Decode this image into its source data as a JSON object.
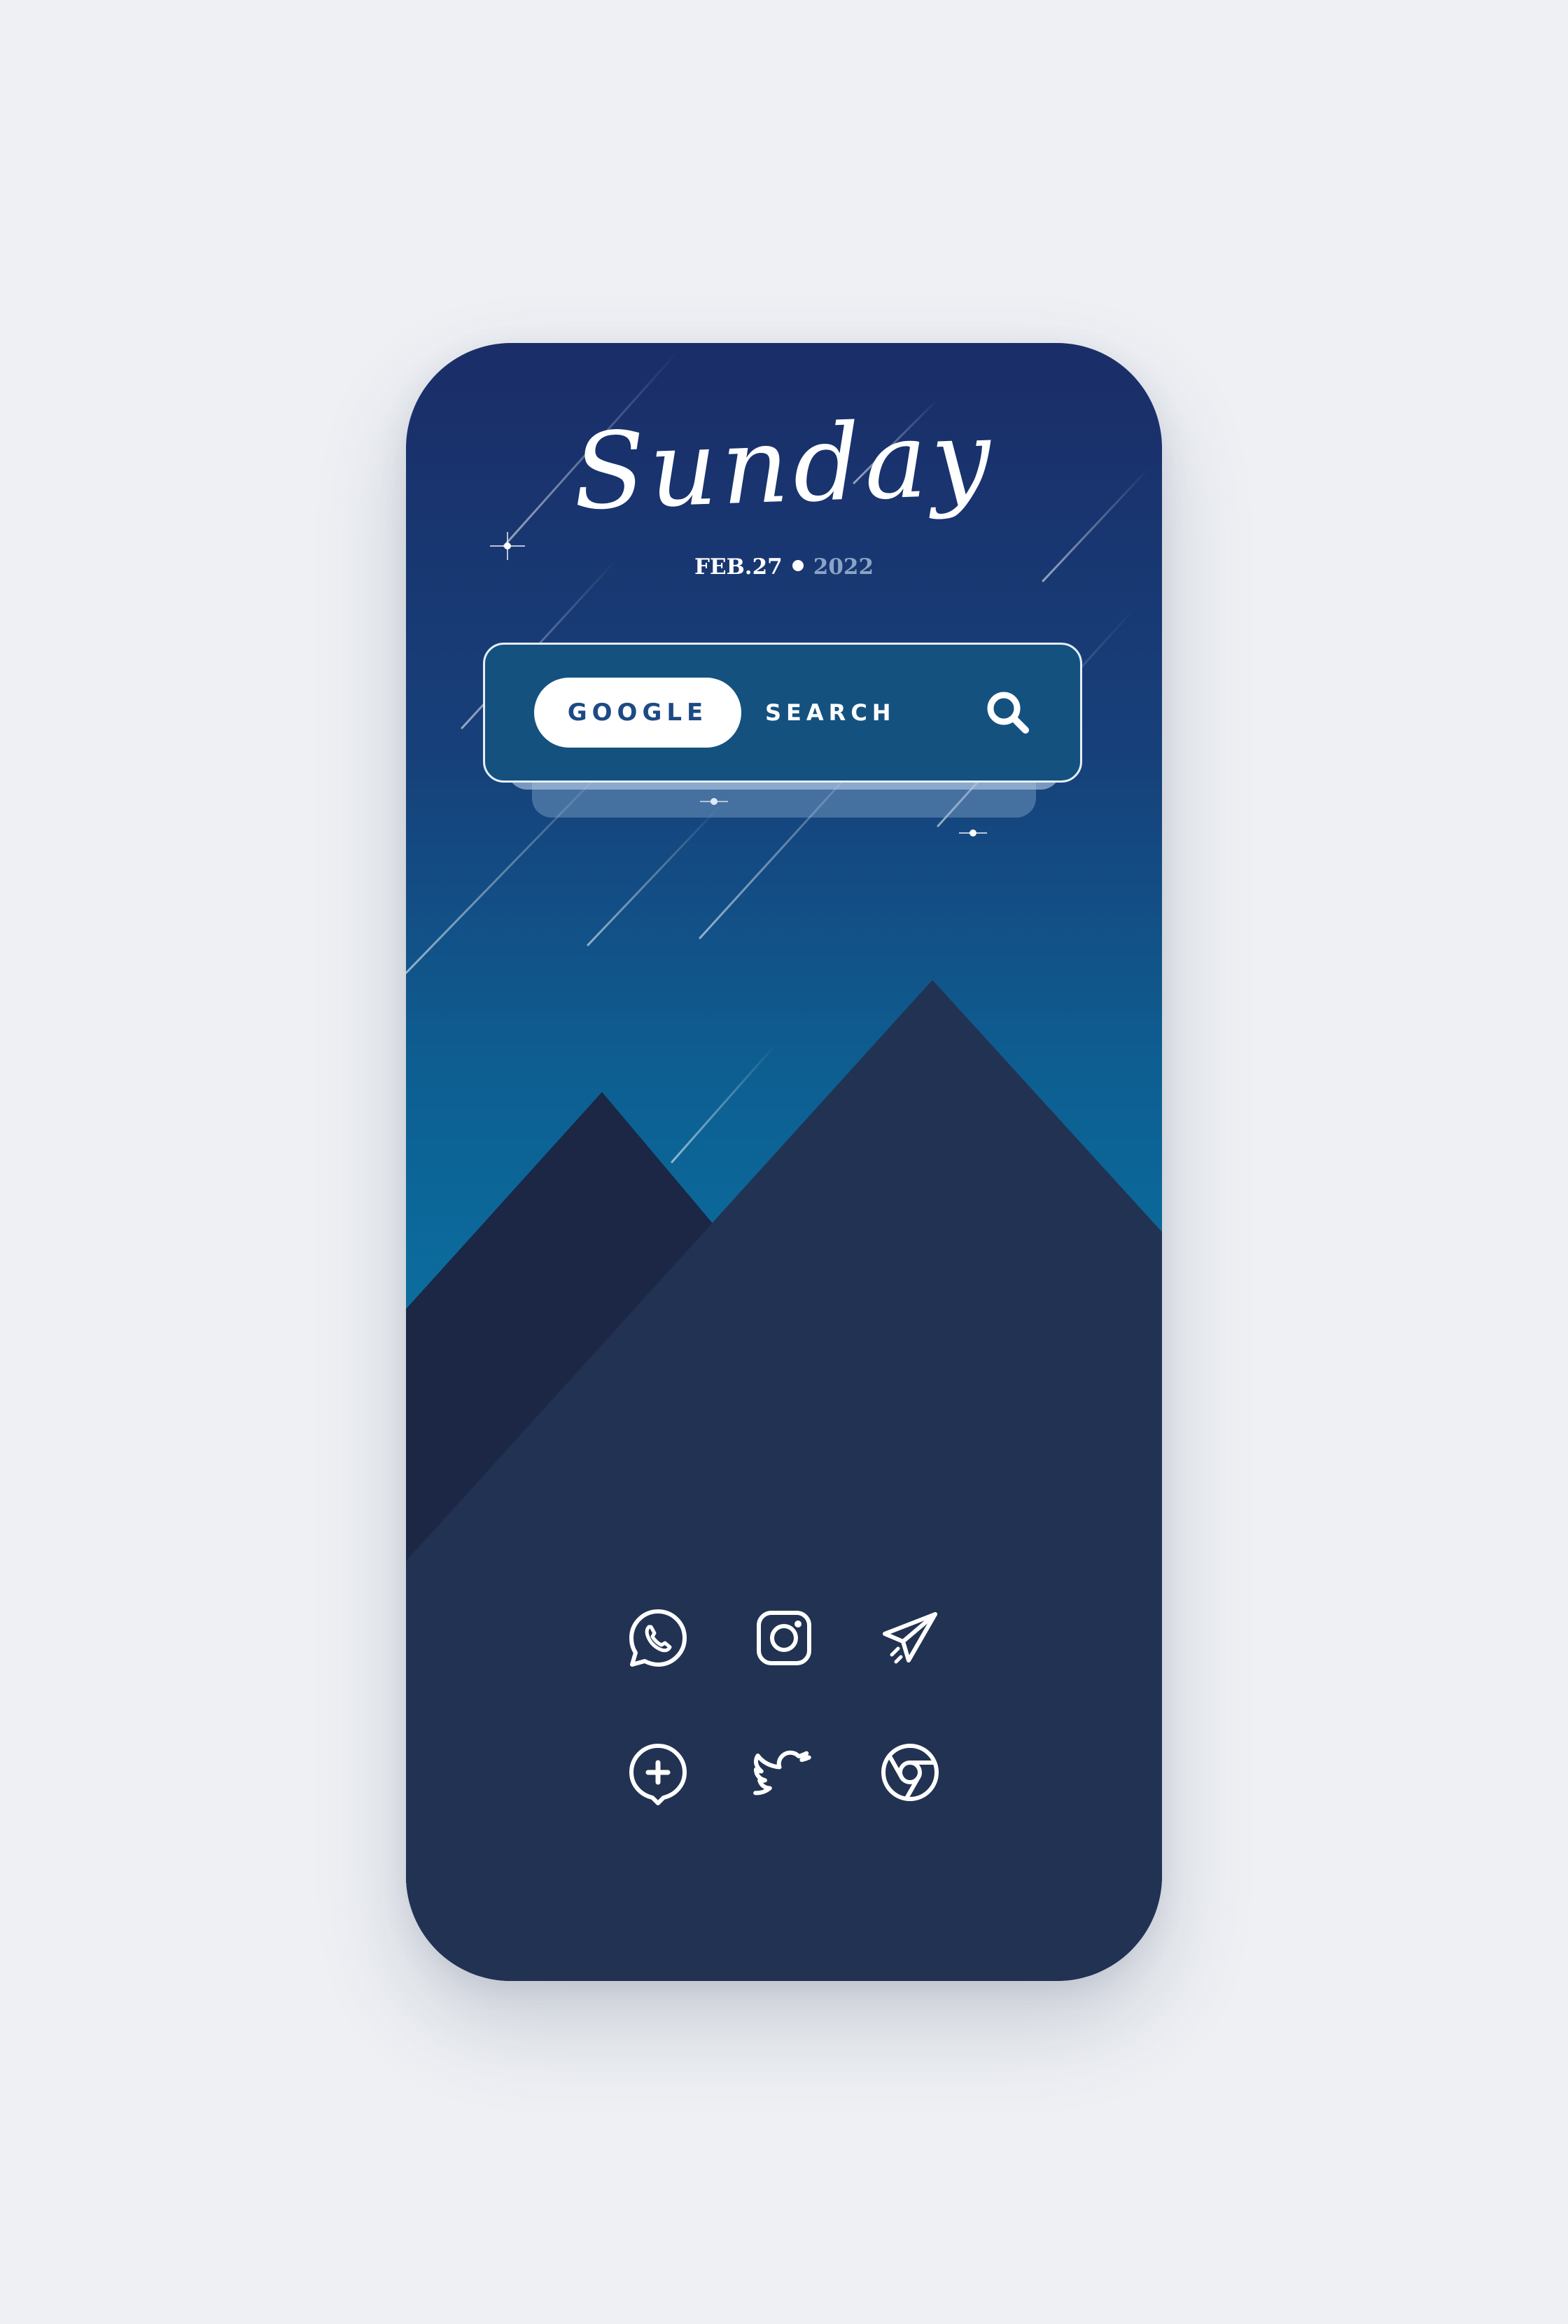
{
  "home": {
    "day": "Sunday",
    "date": "FEB.27",
    "year": "2022"
  },
  "search_widget": {
    "google_label": "GOOGLE",
    "search_label": "SEARCH",
    "icon": "search-icon"
  },
  "apps": [
    {
      "name": "whatsapp",
      "icon": "whatsapp-icon"
    },
    {
      "name": "instagram",
      "icon": "instagram-icon"
    },
    {
      "name": "telegram",
      "icon": "telegram-icon"
    },
    {
      "name": "messages",
      "icon": "chat-plus-icon"
    },
    {
      "name": "twitter",
      "icon": "twitter-icon"
    },
    {
      "name": "chrome",
      "icon": "chrome-icon"
    }
  ],
  "colors": {
    "sky_top": "#1a2d68",
    "sky_bottom": "#0a6a9a",
    "mountain_front": "#223252",
    "mountain_back": "#1b2744",
    "page_background": "#eef0f4"
  }
}
